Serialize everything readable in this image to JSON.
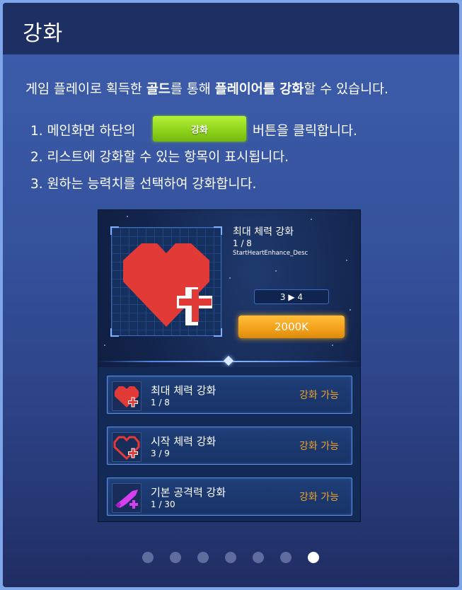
{
  "header": {
    "title": "강화"
  },
  "description": {
    "part1": "게임 플레이로 획득한 ",
    "bold1": "골드",
    "part2": "를 통해 ",
    "bold2": "플레이어를 강화",
    "part3": "할 수 있습니다."
  },
  "steps": {
    "step1_before": "1. 메인화면 하단의",
    "step1_button": "강화",
    "step1_after": "버튼을 클릭합니다.",
    "step2": "2. 리스트에 강화할 수 있는 항목이 표시됩니다.",
    "step3": "3. 원하는 능력치를 선택하여 강화합니다."
  },
  "panel": {
    "selected": {
      "title": "최대 체력 강화",
      "level": "1 / 8",
      "desc": "StartHeartEnhance_Desc",
      "level_change": "3 ▶ 4",
      "cost": "2000K"
    },
    "items": [
      {
        "title": "최대 체력 강화",
        "level": "1 / 8",
        "status": "강화 가능",
        "icon": "heart-plus-icon"
      },
      {
        "title": "시작 체력 강화",
        "level": "3 / 9",
        "status": "강화 가능",
        "icon": "heart-outline-plus-icon"
      },
      {
        "title": "기본 공격력 강화",
        "level": "1 / 30",
        "status": "강화 가능",
        "icon": "sword-plus-icon"
      }
    ]
  },
  "pagination": {
    "total": 7,
    "current": 7
  },
  "colors": {
    "accent_green": "#9ee02a",
    "cost_orange": "#f3a01a",
    "status_orange": "#f3a42a",
    "heart_red": "#e23a36"
  }
}
